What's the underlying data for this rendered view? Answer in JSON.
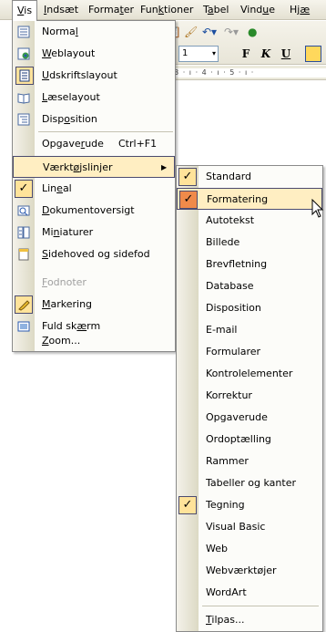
{
  "menubar": {
    "items": [
      "Vis",
      "Indsæt",
      "Formater",
      "Funktioner",
      "Tabel",
      "Vindue",
      "Hjæ"
    ]
  },
  "toolbar": {
    "font_size": "1",
    "bold": "F",
    "italic": "K",
    "underline": "U",
    "ruler_text": "· 3 · ı · 4 · ı · 5 · ı ·"
  },
  "view_menu": {
    "items": [
      {
        "label": "Normal",
        "icon": "normal-view-icon"
      },
      {
        "label": "Weblayout",
        "icon": "web-layout-icon"
      },
      {
        "label": "Udskriftslayout",
        "icon": "print-layout-icon",
        "checked_icon": true
      },
      {
        "label": "Læselayout",
        "icon": "reading-layout-icon"
      },
      {
        "label": "Disposition",
        "icon": "outline-view-icon"
      },
      {
        "label": "Opgaverude",
        "shortcut": "Ctrl+F1"
      },
      {
        "label": "Værktøjslinjer",
        "submenu": true
      },
      {
        "label": "Lineal",
        "checked": true
      },
      {
        "label": "Dokumentoversigt",
        "icon": "document-map-icon"
      },
      {
        "label": "Miniaturer",
        "icon": "thumbnails-icon"
      },
      {
        "label": "Sidehoved og sidefod",
        "icon": "header-footer-icon"
      },
      {
        "label": "Fodnoter",
        "disabled": true
      },
      {
        "label": "Markering",
        "icon": "markup-icon",
        "checked_icon": true
      },
      {
        "label": "Fuld skærm",
        "icon": "full-screen-icon"
      },
      {
        "label": "Zoom..."
      }
    ]
  },
  "toolbars_submenu": {
    "items": [
      {
        "label": "Standard",
        "checked": true
      },
      {
        "label": "Formatering",
        "checked": true
      },
      {
        "label": "Autotekst"
      },
      {
        "label": "Billede"
      },
      {
        "label": "Brevfletning"
      },
      {
        "label": "Database"
      },
      {
        "label": "Disposition"
      },
      {
        "label": "E-mail"
      },
      {
        "label": "Formularer"
      },
      {
        "label": "Kontrolelementer"
      },
      {
        "label": "Korrektur"
      },
      {
        "label": "Opgaverude"
      },
      {
        "label": "Ordoptælling"
      },
      {
        "label": "Rammer"
      },
      {
        "label": "Tabeller og kanter"
      },
      {
        "label": "Tegning",
        "checked": true
      },
      {
        "label": "Visual Basic"
      },
      {
        "label": "Web"
      },
      {
        "label": "Webværktøjer"
      },
      {
        "label": "WordArt"
      },
      {
        "label": "Tilpas..."
      }
    ]
  },
  "colors": {
    "hover": "#ffeec2",
    "check": "#ffe39a",
    "check_hover": "#f08a4a",
    "menu_border": "#8a8a8a"
  }
}
